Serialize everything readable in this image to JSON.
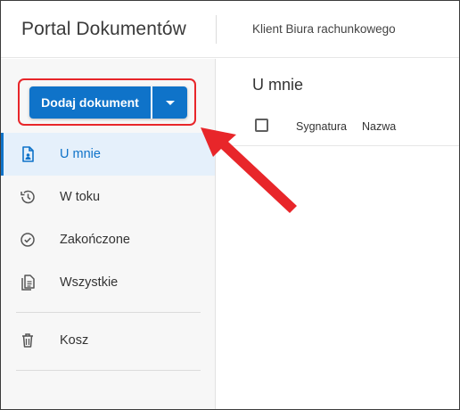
{
  "header": {
    "app_title": "Portal Dokumentów",
    "client_label": "Klient Biura rachunkowego"
  },
  "sidebar": {
    "add_button_label": "Dodaj dokument",
    "items": [
      {
        "label": "U mnie",
        "icon": "document-person-icon",
        "active": true
      },
      {
        "label": "W toku",
        "icon": "clock-history-icon",
        "active": false
      },
      {
        "label": "Zakończone",
        "icon": "check-circle-icon",
        "active": false
      },
      {
        "label": "Wszystkie",
        "icon": "documents-icon",
        "active": false
      },
      {
        "label": "Kosz",
        "icon": "trash-icon",
        "active": false
      }
    ]
  },
  "main": {
    "title": "U mnie",
    "columns": [
      "Sygnatura",
      "Nazwa"
    ]
  },
  "colors": {
    "accent": "#0f73c9",
    "active_bg": "#e5f0fb",
    "annotation_red": "#e8262a"
  }
}
